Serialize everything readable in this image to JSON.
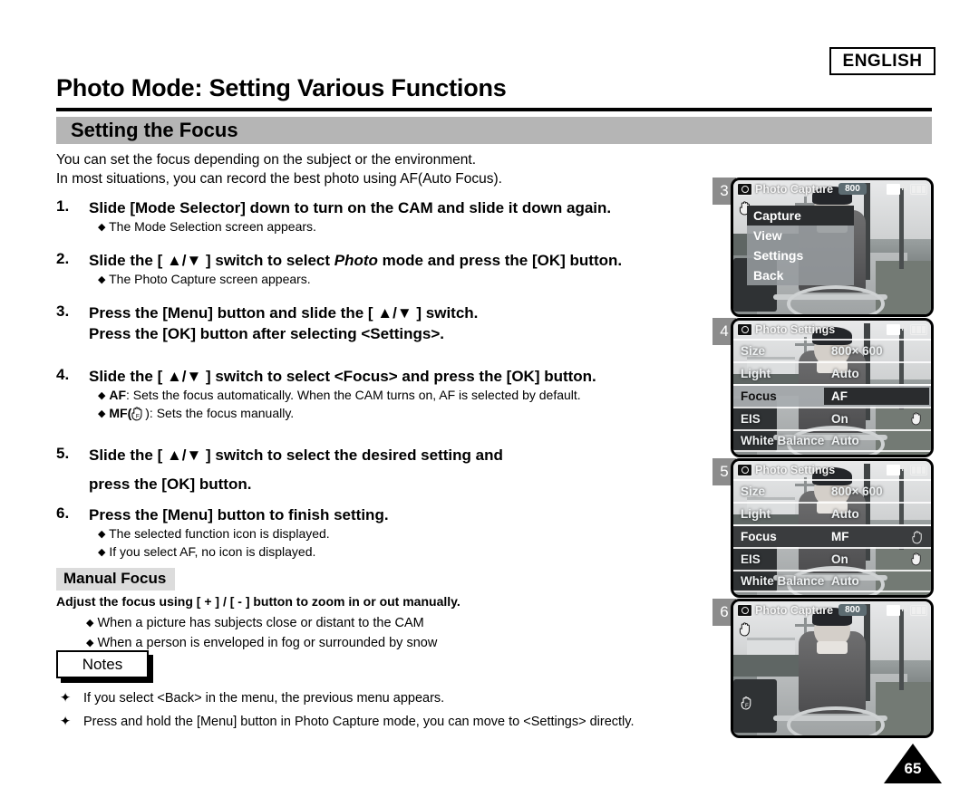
{
  "header": {
    "language_badge": "ENGLISH",
    "title": "Photo Mode: Setting Various Functions",
    "section_title": "Setting the Focus"
  },
  "intro": {
    "line1": "You can set the focus depending on the subject or the environment.",
    "line2": "In most situations, you can record the best photo using AF(Auto Focus)."
  },
  "steps": [
    {
      "num": "1.",
      "head": "Slide [Mode Selector] down to turn on the CAM and slide it down again.",
      "subs": [
        "The Mode Selection screen appears."
      ]
    },
    {
      "num": "2.",
      "head_a": "Slide the [ ▲/▼ ] switch to select ",
      "head_italic": "Photo",
      "head_b": " mode and press the [OK] button.",
      "subs": [
        "The Photo Capture screen appears."
      ]
    },
    {
      "num": "3.",
      "head": "Press the [Menu] button and slide the [ ▲/▼ ] switch.",
      "head2": "Press the [OK] button after selecting <Settings>.",
      "subs": []
    },
    {
      "num": "4.",
      "head": "Slide the [ ▲/▼ ] switch to select <Focus> and press the [OK] button.",
      "sub_af_bold": "AF",
      "sub_af_rest": ": Sets the focus automatically. When the CAM turns on, AF is selected by default.",
      "sub_mf_bold": "MF(",
      "sub_mf_rest": "): Sets the focus manually."
    },
    {
      "num": "5.",
      "head": "Slide the [ ▲/▼ ] switch to select the desired setting and",
      "head2": "press the [OK] button.",
      "subs": []
    },
    {
      "num": "6.",
      "head": "Press the [Menu] button to finish setting.",
      "subs": [
        "The selected function icon is displayed.",
        "If you select  AF, no icon is displayed."
      ]
    }
  ],
  "manual_focus": {
    "heading": "Manual Focus",
    "lead": "Adjust the focus using [ + ] / [ - ] button to zoom in or out manually.",
    "bullets": [
      "When a picture has subjects close or distant to the CAM",
      "When a person is enveloped in fog or surrounded by snow"
    ]
  },
  "notes": {
    "label": "Notes",
    "marker": "✦",
    "items": [
      "If you select <Back> in the menu, the previous menu appears.",
      "Press and hold the [Menu] button in Photo Capture mode, you can move to <Settings> directly."
    ]
  },
  "page_number": "65",
  "panels": [
    {
      "num": "3",
      "osd_title": "Photo Capture",
      "size_badge": "800",
      "type": "menu",
      "menu_items": [
        {
          "label": "Capture",
          "selected": true
        },
        {
          "label": "View",
          "selected": false
        },
        {
          "label": "Settings",
          "selected": false
        },
        {
          "label": "Back",
          "selected": false
        }
      ]
    },
    {
      "num": "4",
      "osd_title": "Photo Settings",
      "size_badge": "",
      "type": "settings",
      "rows": [
        {
          "label": "Size",
          "value": "800× 600",
          "state": "normal"
        },
        {
          "label": "Light",
          "value": "Auto",
          "state": "normal"
        },
        {
          "label": "Focus",
          "value": "AF",
          "state": "chip"
        },
        {
          "label": "EIS",
          "value": "On",
          "state": "hand"
        },
        {
          "label": "White Balance",
          "value": "Auto",
          "state": "normal"
        }
      ]
    },
    {
      "num": "5",
      "osd_title": "Photo Settings",
      "size_badge": "",
      "type": "settings",
      "rows": [
        {
          "label": "Size",
          "value": "800× 600",
          "state": "normal"
        },
        {
          "label": "Light",
          "value": "Auto",
          "state": "normal"
        },
        {
          "label": "Focus",
          "value": "MF",
          "state": "rowdark-hand"
        },
        {
          "label": "EIS",
          "value": "On",
          "state": "hand"
        },
        {
          "label": "White Balance",
          "value": "Auto",
          "state": "normal"
        }
      ]
    },
    {
      "num": "6",
      "osd_title": "Photo Capture",
      "size_badge": "800",
      "type": "capture",
      "mf_icon": true
    }
  ]
}
